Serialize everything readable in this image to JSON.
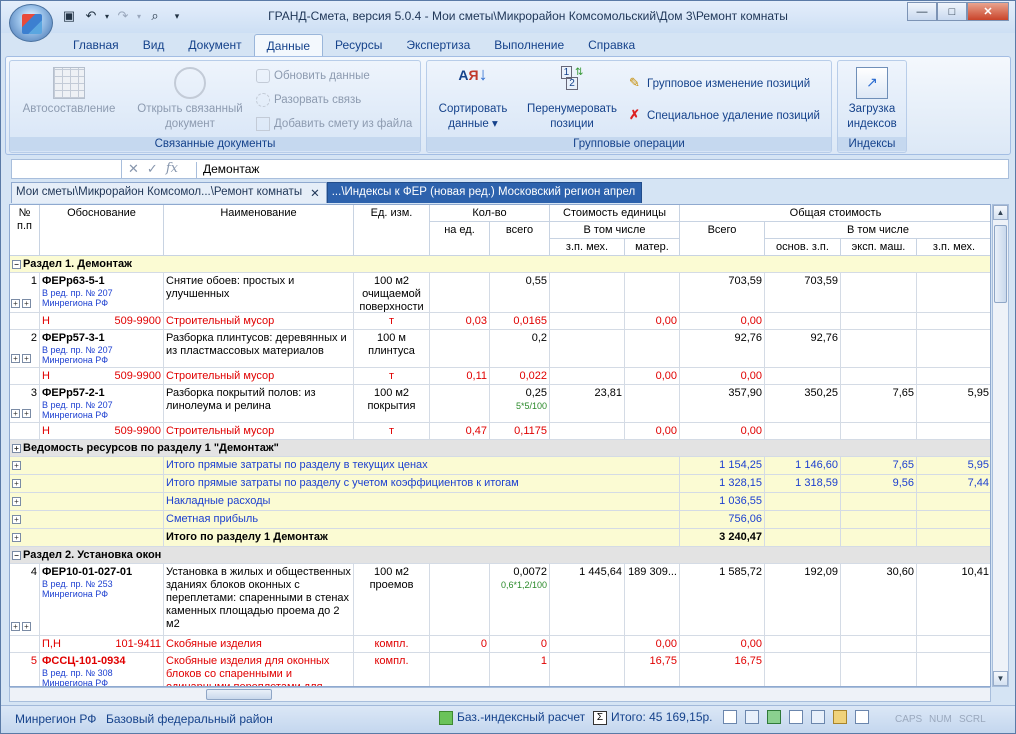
{
  "window": {
    "title": "ГРАНД-Смета, версия 5.0.4 - Мои сметы\\Микрорайон Комсомольский\\Дом 3\\Ремонт комнаты"
  },
  "ribbon_tabs": [
    "Главная",
    "Вид",
    "Документ",
    "Данные",
    "Ресурсы",
    "Экспертиза",
    "Выполнение",
    "Справка"
  ],
  "ribbon": {
    "group1": {
      "label": "Связанные документы",
      "auto": "Автосоставление",
      "open_linked_1": "Открыть связанный",
      "open_linked_2": "документ",
      "refresh": "Обновить данные",
      "break_link": "Разорвать связь",
      "add_from_file": "Добавить смету из файла"
    },
    "group2": {
      "label": "Групповые операции",
      "sort_1": "Сортировать",
      "sort_2": "данные",
      "renumber_1": "Перенумеровать",
      "renumber_2": "позиции",
      "group_change": "Групповое изменение позиций",
      "special_delete": "Специальное удаление позиций"
    },
    "group3": {
      "label": "Индексы",
      "load_1": "Загрузка",
      "load_2": "индексов"
    }
  },
  "formula_bar": {
    "name_box": "",
    "value": "Демонтаж"
  },
  "doc_tabs": [
    "Мои сметы\\Микрорайон Комсомол...\\Ремонт комнаты",
    "...\\Индексы к ФЕР (новая ред.) Московский регион апрел"
  ],
  "headers": {
    "num": "№ п.п",
    "basis": "Обоснование",
    "name": "Наименование",
    "unit": "Ед. изм.",
    "qty": "Кол-во",
    "qty_per": "на ед.",
    "qty_total": "всего",
    "unit_cost": "Стоимость единицы",
    "incl": "В том числе",
    "zp_mach": "з.п. мех.",
    "mater": "матер.",
    "total_cost": "Общая стоимость",
    "all": "Всего",
    "incl2": "В том числе",
    "base_zp": "основ. з.п.",
    "exp_mach": "эксп. маш.",
    "zp_mach2": "з.п. мех."
  },
  "section1": "Раздел 1. Демонтаж",
  "items": [
    {
      "n": "1",
      "code": "ФЕРр63-5-1",
      "ref": "В ред. пр. № 207",
      "reg": "Минрегиона РФ",
      "name": "Снятие обоев: простых и улучшенных",
      "unit": "100 м2 очищаемой поверхности",
      "qty_total": "0,55",
      "formula": "",
      "zp": "",
      "mat": "",
      "total": "703,59",
      "base": "703,59",
      "exp": "",
      "zpm": "",
      "sub": {
        "t": "Н",
        "code": "509-9900",
        "name": "Строительный мусор",
        "unit": "т",
        "per": "0,03",
        "tot": "0,0165",
        "mat": "0,00",
        "total": "0,00"
      }
    },
    {
      "n": "2",
      "code": "ФЕРр57-3-1",
      "ref": "В ред. пр. № 207",
      "reg": "Минрегиона РФ",
      "name": "Разборка плинтусов: деревянных и из пластмассовых материалов",
      "unit": "100 м плинтуса",
      "qty_total": "0,2",
      "formula": "",
      "zp": "",
      "mat": "",
      "total": "92,76",
      "base": "92,76",
      "exp": "",
      "zpm": "",
      "sub": {
        "t": "Н",
        "code": "509-9900",
        "name": "Строительный мусор",
        "unit": "т",
        "per": "0,11",
        "tot": "0,022",
        "mat": "0,00",
        "total": "0,00"
      }
    },
    {
      "n": "3",
      "code": "ФЕРр57-2-1",
      "ref": "В ред. пр. № 207",
      "reg": "Минрегиона РФ",
      "name": "Разборка покрытий полов: из линолеума и релина",
      "unit": "100 м2 покрытия",
      "qty_total": "0,25",
      "formula": "5*5/100",
      "zp": "23,81",
      "mat": "",
      "total": "357,90",
      "base": "350,25",
      "exp": "7,65",
      "zpm": "5,95",
      "sub": {
        "t": "Н",
        "code": "509-9900",
        "name": "Строительный мусор",
        "unit": "т",
        "per": "0,47",
        "tot": "0,1175",
        "mat": "0,00",
        "total": "0,00"
      }
    }
  ],
  "resources_row": "Ведомость ресурсов по разделу 1 \"Демонтаж\"",
  "totals": [
    {
      "label": "Итого прямые затраты по разделу в текущих ценах",
      "all": "1 154,25",
      "base": "1 146,60",
      "exp": "7,65",
      "zpm": "5,95"
    },
    {
      "label": "Итого прямые затраты по разделу с учетом коэффициентов к итогам",
      "all": "1 328,15",
      "base": "1 318,59",
      "exp": "9,56",
      "zpm": "7,44"
    },
    {
      "label": "Накладные расходы",
      "all": "1 036,55",
      "base": "",
      "exp": "",
      "zpm": ""
    },
    {
      "label": "Сметная прибыль",
      "all": "756,06",
      "base": "",
      "exp": "",
      "zpm": ""
    }
  ],
  "section1_total": {
    "label": "Итого по разделу 1 Демонтаж",
    "all": "3 240,47"
  },
  "section2": "Раздел 2. Установка окон",
  "item4": {
    "n": "4",
    "code": "ФЕР10-01-027-01",
    "ref": "В ред. пр. № 253",
    "reg": "Минрегиона РФ",
    "name": "Установка в жилых и общественных зданиях блоков оконных с переплетами: спаренными в стенах каменных площадью проема до 2 м2",
    "unit": "100 м2 проемов",
    "qty_total": "0,0072",
    "formula": "0,6*1,2/100",
    "zp": "1 445,64",
    "mat": "189 309...",
    "total": "1 585,72",
    "base": "192,09",
    "exp": "30,60",
    "zpm": "10,41",
    "sub": {
      "t": "П,Н",
      "code": "101-9411",
      "name": "Скобяные изделия",
      "unit": "компл.",
      "per": "0",
      "tot": "0",
      "mat": "0,00",
      "total": "0,00"
    }
  },
  "item5": {
    "n": "5",
    "code": "ФССЦ-101-0934",
    "ref": "В ред. пр. № 308",
    "reg": "Минрегиона РФ",
    "name": "Скобяные изделия для оконных блоков со спаренными и одинарными переплетами для",
    "unit": "компл.",
    "qty_total": "1",
    "mat": "16,75",
    "total": "16,75"
  },
  "status": {
    "region": "Минрегион РФ",
    "district": "Базовый федеральный район",
    "calc": "Баз.-индексный расчет",
    "total": "Итого: 45 169,15р.",
    "caps": "CAPS",
    "num": "NUM",
    "scrl": "SCRL"
  }
}
